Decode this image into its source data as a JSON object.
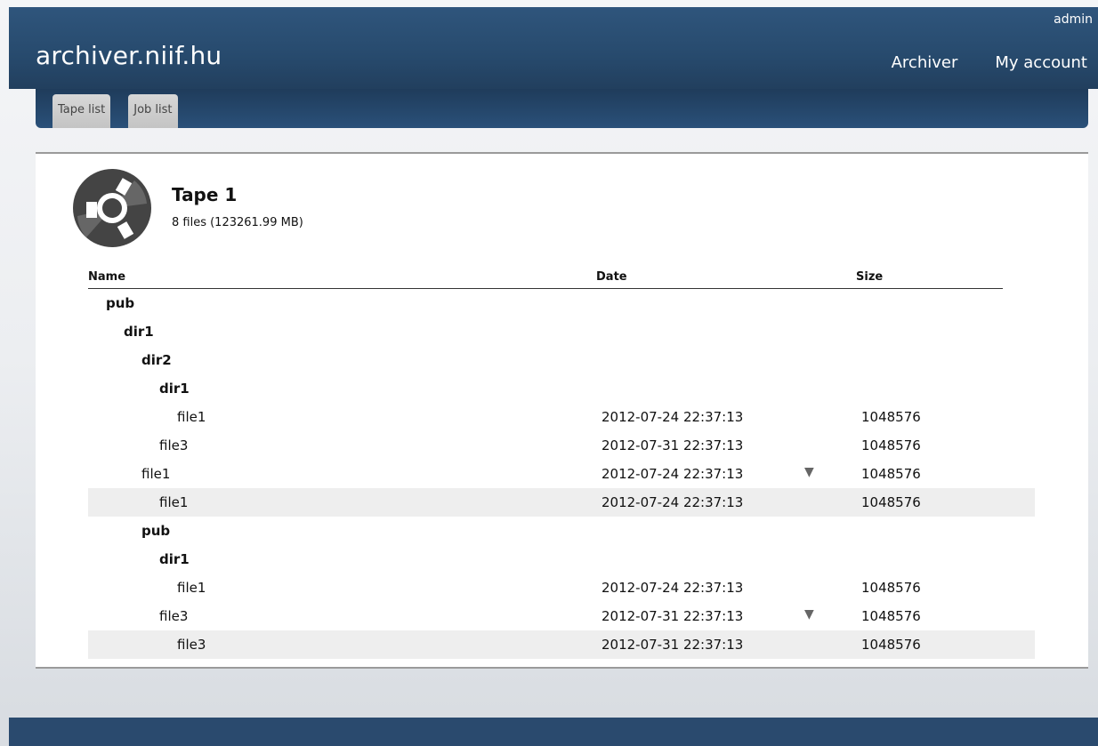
{
  "header": {
    "site_title": "archiver.niif.hu",
    "user": "admin",
    "nav": [
      "Archiver",
      "My account"
    ]
  },
  "tabs": [
    "Tape list",
    "Job list"
  ],
  "tape": {
    "title": "Tape 1",
    "summary": "8 files (123261.99 MB)"
  },
  "table": {
    "columns": [
      "Name",
      "Date",
      "Size"
    ],
    "rows": [
      {
        "name": "pub",
        "type": "dir",
        "level": 0,
        "date": "",
        "size": ""
      },
      {
        "name": "dir1",
        "type": "dir",
        "level": 1,
        "date": "",
        "size": ""
      },
      {
        "name": "dir2",
        "type": "dir",
        "level": 2,
        "date": "",
        "size": ""
      },
      {
        "name": "dir1",
        "type": "dir",
        "level": 3,
        "date": "",
        "size": ""
      },
      {
        "name": "file1",
        "type": "file",
        "level": 4,
        "date": "2012-07-24 22:37:13",
        "size": "1048576"
      },
      {
        "name": "file3",
        "type": "file",
        "level": 3,
        "date": "2012-07-31 22:37:13",
        "size": "1048576"
      },
      {
        "name": "file1",
        "type": "file",
        "level": 2,
        "date": "2012-07-24 22:37:13",
        "size": "1048576",
        "expander": true
      },
      {
        "name": "file1",
        "type": "file",
        "level": 3,
        "date": "2012-07-24 22:37:13",
        "size": "1048576",
        "highlight": true
      },
      {
        "name": "pub",
        "type": "dir",
        "level": 2,
        "date": "",
        "size": ""
      },
      {
        "name": "dir1",
        "type": "dir",
        "level": 3,
        "date": "",
        "size": ""
      },
      {
        "name": "file1",
        "type": "file",
        "level": 4,
        "date": "2012-07-24 22:37:13",
        "size": "1048576"
      },
      {
        "name": "file3",
        "type": "file",
        "level": 3,
        "date": "2012-07-31 22:37:13",
        "size": "1048576",
        "expander": true
      },
      {
        "name": "file3",
        "type": "file",
        "level": 4,
        "date": "2012-07-31 22:37:13",
        "size": "1048576",
        "highlight": true
      }
    ]
  },
  "icons": {
    "expander": "triangle-down-icon",
    "tape": "tape-reel-icon"
  },
  "colors": {
    "header": "#2b4f76",
    "footer": "#2a4a6e",
    "highlight_row": "#eeeeee"
  }
}
